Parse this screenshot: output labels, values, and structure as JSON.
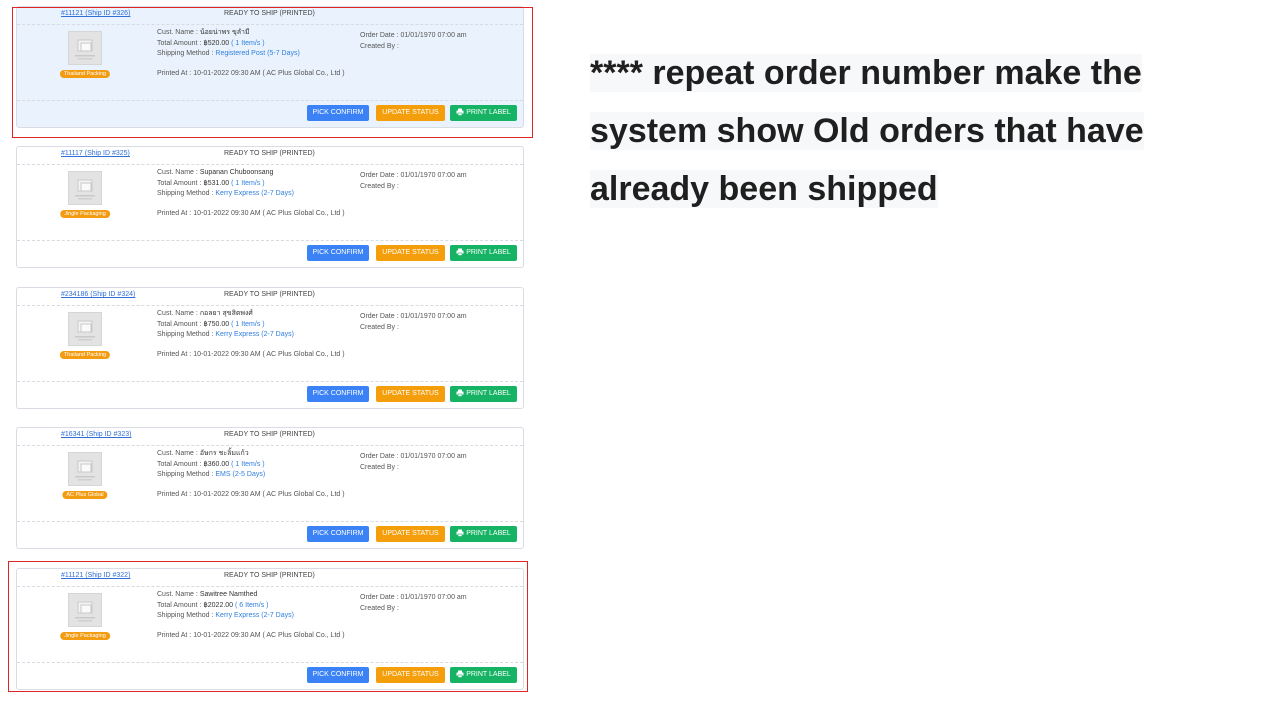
{
  "colors": {
    "link": "#2f6fd6",
    "pick_confirm": "#3b82f6",
    "update_status": "#f59e0b",
    "print_label": "#16b364",
    "badge": "#f39c12",
    "highlight_border": "#e02424"
  },
  "labels": {
    "cust_name": "Cust. Name :",
    "total_amount": "Total Amount :",
    "shipping_method": "Shipping Method :",
    "printed_at": "Printed At :",
    "order_date": "Order Date :",
    "created_by": "Created By :",
    "pick_confirm": "PICK CONFIRM",
    "update_status": "UPDATE STATUS",
    "print_label": "PRINT LABEL",
    "thumb_icon": "image-placeholder-icon",
    "print_icon": "printer-icon"
  },
  "orders": [
    {
      "order_link": "#11121 (Ship ID #326)",
      "status": "READY TO SHIP (PRINTED)",
      "badge": "Thailand Packing",
      "cust_name": "น้อยน่าพร ขุลำมี",
      "amount": "฿520.00",
      "items": "( 1 Item/s )",
      "shipping": "Registered Post (5-7 Days)",
      "printed_at": "10-01-2022 09:30 AM ( AC Plus Global Co., Ltd )",
      "order_date": "01/01/1970 07:00 am",
      "created_by": "",
      "highlighted": true
    },
    {
      "order_link": "#11117 (Ship ID #325)",
      "status": "READY TO SHIP (PRINTED)",
      "badge": "Jingle Packaging",
      "cust_name": "Supanan Chuboonsang",
      "amount": "฿531.00",
      "items": "( 1 Item/s )",
      "shipping": "Kerry Express (2-7 Days)",
      "printed_at": "10-01-2022 09:30 AM ( AC Plus Global Co., Ltd )",
      "order_date": "01/01/1970 07:00 am",
      "created_by": "",
      "highlighted": false
    },
    {
      "order_link": "#234186 (Ship ID #324)",
      "status": "READY TO SHIP (PRINTED)",
      "badge": "Thailand Packing",
      "cust_name": "กอลยา สุขสิตพงศ์",
      "amount": "฿750.00",
      "items": "( 1 Item/s )",
      "shipping": "Kerry Express (2-7 Days)",
      "printed_at": "10-01-2022 09:30 AM ( AC Plus Global Co., Ltd )",
      "order_date": "01/01/1970 07:00 am",
      "created_by": "",
      "highlighted": false
    },
    {
      "order_link": "#16341 (Ship ID #323)",
      "status": "READY TO SHIP (PRINTED)",
      "badge": "AC Plus Global",
      "cust_name": "อัษกร ชะลิ้มแก้ว",
      "amount": "฿360.00",
      "items": "( 1 Item/s )",
      "shipping": "EMS (2-5 Days)",
      "printed_at": "10-01-2022 09:30 AM ( AC Plus Global Co., Ltd )",
      "order_date": "01/01/1970 07:00 am",
      "created_by": "",
      "highlighted": false
    },
    {
      "order_link": "#11121 (Ship ID #322)",
      "status": "READY TO SHIP (PRINTED)",
      "badge": "Jingle Packaging",
      "cust_name": "Sawitree Namthed",
      "amount": "฿2022.00",
      "items": "( 6 Item/s )",
      "shipping": "Kerry Express (2-7 Days)",
      "printed_at": "10-01-2022 09:30 AM ( AC Plus Global Co., Ltd )",
      "order_date": "01/01/1970 07:00 am",
      "created_by": "",
      "highlighted": true
    }
  ],
  "note": {
    "line1": "**** repeat order number make the",
    "line2": "system show Old orders that have",
    "line3": "already been shipped"
  }
}
